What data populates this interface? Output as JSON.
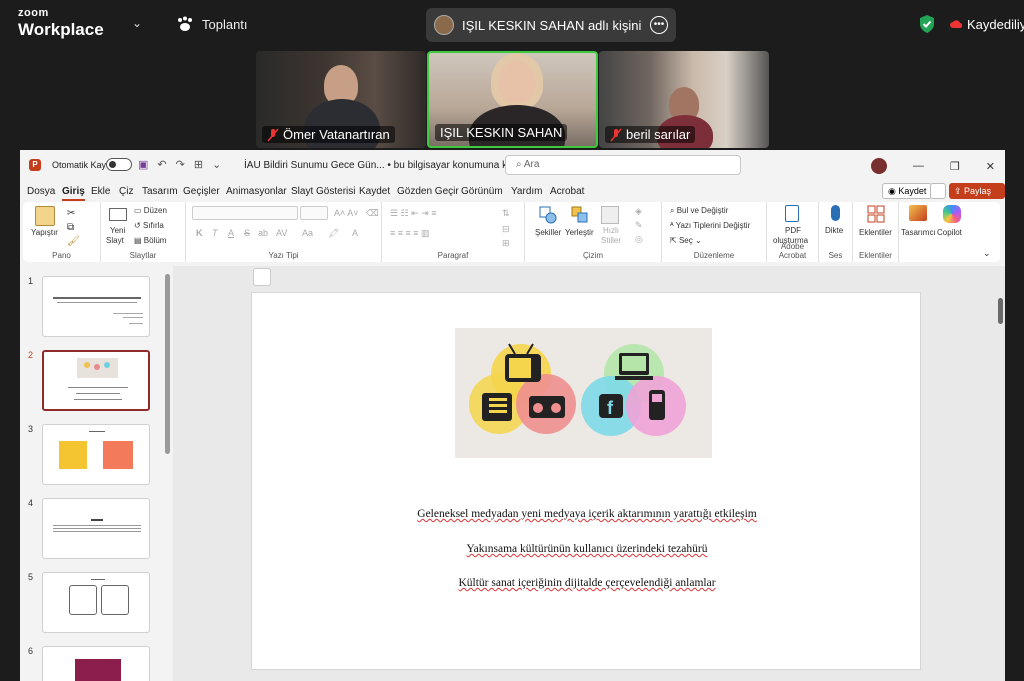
{
  "zoom": {
    "logo_top": "zoom",
    "logo_bottom": "Workplace",
    "meeting_label": "Toplantı",
    "share_title": "IŞIL KESKIN SAHAN adlı kişinin e",
    "saving_status": "Kaydediliy"
  },
  "participants": [
    {
      "name": "Ömer Vatanartıran",
      "muted": true
    },
    {
      "name": "IŞIL KESKIN SAHAN",
      "muted": false
    },
    {
      "name": "beril sarılar",
      "muted": true
    }
  ],
  "ppt": {
    "autosave_label": "Otomatik Kaydet",
    "document_name": "İAU Bildiri Sunumu Gece Gün... • bu bilgisayar konumuna kaydedildi",
    "search_placeholder": "Ara",
    "menu": [
      "Dosya",
      "Giriş",
      "Ekle",
      "Çiz",
      "Tasarım",
      "Geçişler",
      "Animasyonlar",
      "Slayt Gösterisi",
      "Kaydet",
      "Gözden Geçir",
      "Görünüm",
      "Yardım",
      "Acrobat"
    ],
    "active_tab": "Giriş",
    "kaydet_button": "Kaydet",
    "share_button": "Paylaş",
    "ribbon": {
      "pano": {
        "name": "Pano",
        "paste": "Yapıştır"
      },
      "slaytlar": {
        "name": "Slaytlar",
        "new_slide_1": "Yeni",
        "new_slide_2": "Slayt",
        "layout": "Düzen",
        "reset": "Sıfırla",
        "section": "Bölüm"
      },
      "yazi_tipi": {
        "name": "Yazı Tipi",
        "bold": "K",
        "italic": "T",
        "underline": "A",
        "strike": "S",
        "spacing": "AV",
        "case": "Aa"
      },
      "paragraf": {
        "name": "Paragraf"
      },
      "cizim": {
        "name": "Çizim",
        "shapes": "Şekiller",
        "arrange": "Yerleştir",
        "quick_styles_1": "Hızlı",
        "quick_styles_2": "Stiller"
      },
      "duzenleme": {
        "name": "Düzenleme",
        "find": "Bul ve Değiştir",
        "replace_fonts": "Yazı Tiplerini Değiştir",
        "select": "Seç"
      },
      "acrobat": {
        "name": "Adobe Acrobat",
        "pdf_1": "PDF",
        "pdf_2": "oluşturma"
      },
      "ses": {
        "name": "Ses",
        "dictate": "Dikte"
      },
      "eklentiler": {
        "name": "Eklentiler",
        "addins": "Eklentiler"
      },
      "designer": "Tasarımcı",
      "copilot": "Copilot"
    },
    "slides": [
      {
        "num": "1"
      },
      {
        "num": "2"
      },
      {
        "num": "3"
      },
      {
        "num": "4"
      },
      {
        "num": "5"
      },
      {
        "num": "6"
      }
    ],
    "selected_slide": "2",
    "slide_lines": [
      "Geleneksel medyadan yeni medyaya içerik aktarımının yarattığı etkileşim",
      "Yakınsama kültürünün kullanıcı üzerindeki tezahürü",
      "Kültür sanat içeriğinin dijitalde çerçevelendiği anlamlar"
    ]
  }
}
